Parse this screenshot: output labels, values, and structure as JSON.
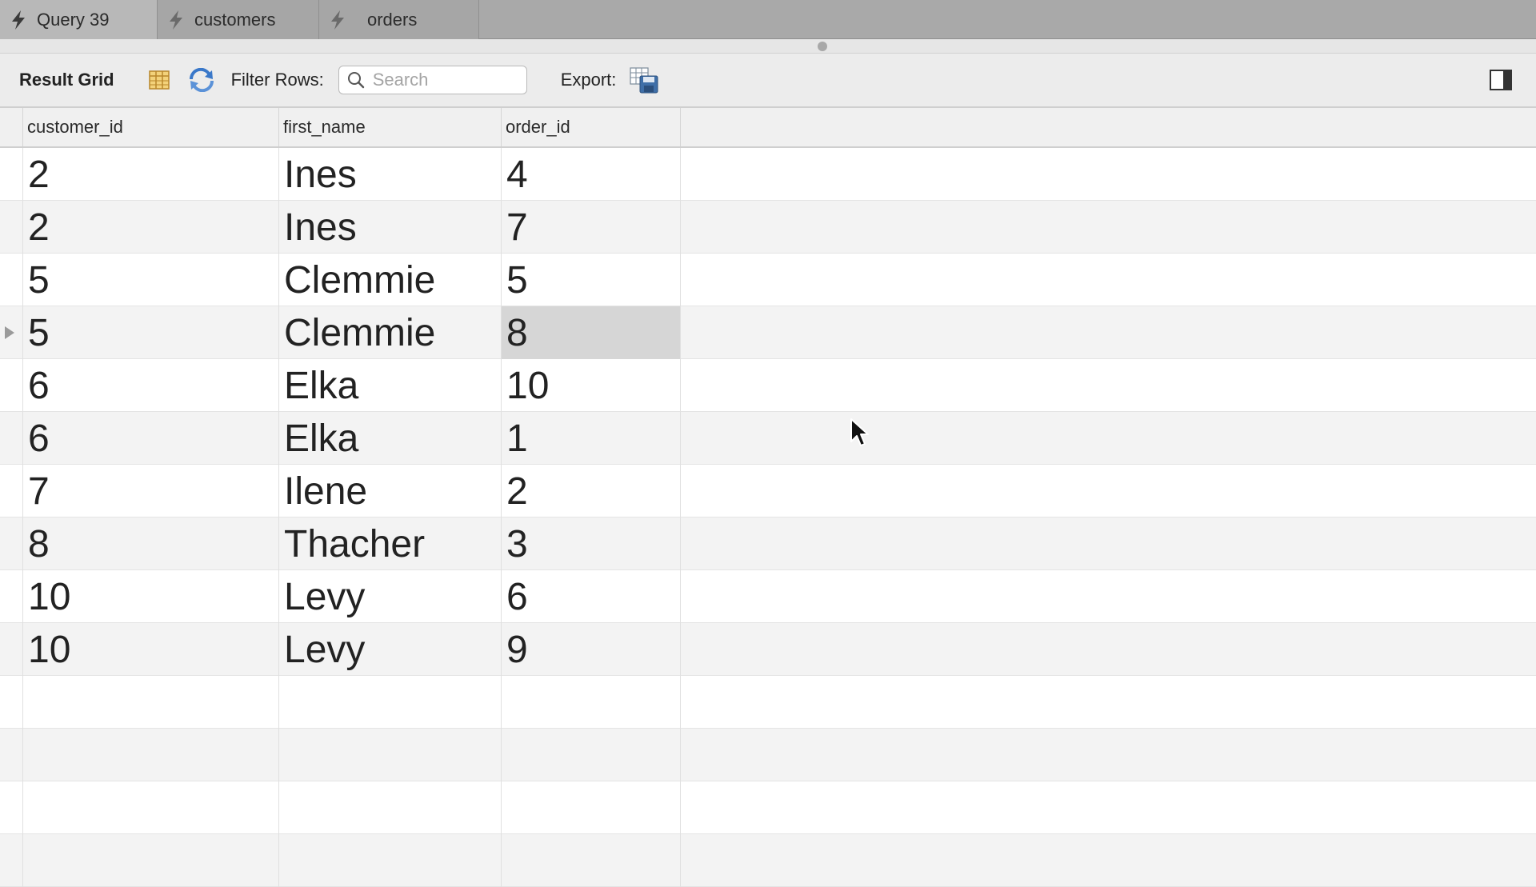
{
  "tabs": [
    {
      "label": "Query 39",
      "active": true
    },
    {
      "label": "customers",
      "active": false
    },
    {
      "label": "orders",
      "active": false
    }
  ],
  "toolbar": {
    "title": "Result Grid",
    "filter_label": "Filter Rows:",
    "search_placeholder": "Search",
    "export_label": "Export:"
  },
  "grid": {
    "columns": [
      "customer_id",
      "first_name",
      "order_id"
    ],
    "rows": [
      [
        "2",
        "Ines",
        "4"
      ],
      [
        "2",
        "Ines",
        "7"
      ],
      [
        "5",
        "Clemmie",
        "5"
      ],
      [
        "5",
        "Clemmie",
        "8"
      ],
      [
        "6",
        "Elka",
        "10"
      ],
      [
        "6",
        "Elka",
        "1"
      ],
      [
        "7",
        "Ilene",
        "2"
      ],
      [
        "8",
        "Thacher",
        "3"
      ],
      [
        "10",
        "Levy",
        "6"
      ],
      [
        "10",
        "Levy",
        "9"
      ]
    ],
    "current_row": 3,
    "selected_cell": {
      "row": 3,
      "col": 2
    }
  },
  "icons": {
    "tab": "lightning-bolt-icon",
    "columns": "column-layout-icon",
    "refresh": "refresh-icon",
    "search": "search-icon",
    "export": "export-icon",
    "panel": "side-panel-toggle-icon",
    "cursor": "mouse-pointer-icon"
  },
  "colors": {
    "selected_cell": "#d6d6d6",
    "refresh_blue": "#3a78c9",
    "columns_yellow": "#e9b949"
  }
}
